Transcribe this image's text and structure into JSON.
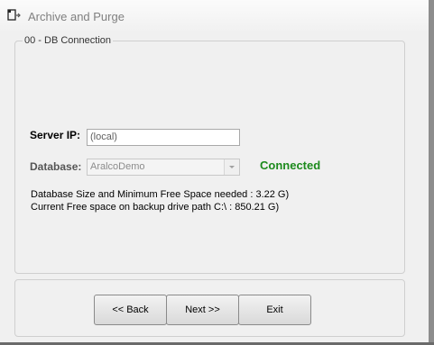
{
  "window": {
    "title": "Archive and Purge",
    "icon": "archive-app-icon"
  },
  "group": {
    "legend": "00 - DB Connection"
  },
  "server": {
    "label": "Server IP:",
    "value": "(local)"
  },
  "database": {
    "label": "Database:",
    "selected": "AralcoDemo",
    "enabled": false
  },
  "status": {
    "text": "Connected",
    "color": "#1c8a1c"
  },
  "info": {
    "line1": "Database Size and Minimum Free Space needed : 3.22 G)",
    "line2": "Current Free space on backup drive path C:\\ : 850.21 G)"
  },
  "buttons": {
    "back": "<< Back",
    "next": "Next >>",
    "exit": "Exit"
  }
}
